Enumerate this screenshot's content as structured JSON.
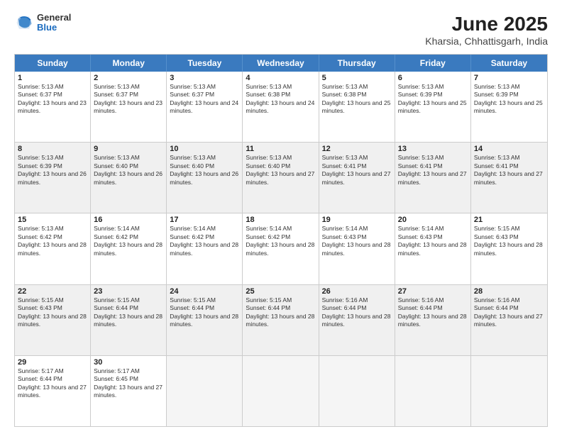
{
  "logo": {
    "general": "General",
    "blue": "Blue"
  },
  "title": {
    "month_year": "June 2025",
    "location": "Kharsia, Chhattisgarh, India"
  },
  "days_of_week": [
    "Sunday",
    "Monday",
    "Tuesday",
    "Wednesday",
    "Thursday",
    "Friday",
    "Saturday"
  ],
  "rows": [
    [
      {
        "day": "",
        "empty": true
      },
      {
        "day": "2",
        "sunrise": "Sunrise: 5:13 AM",
        "sunset": "Sunset: 6:37 PM",
        "daylight": "Daylight: 13 hours and 23 minutes."
      },
      {
        "day": "3",
        "sunrise": "Sunrise: 5:13 AM",
        "sunset": "Sunset: 6:37 PM",
        "daylight": "Daylight: 13 hours and 24 minutes."
      },
      {
        "day": "4",
        "sunrise": "Sunrise: 5:13 AM",
        "sunset": "Sunset: 6:38 PM",
        "daylight": "Daylight: 13 hours and 24 minutes."
      },
      {
        "day": "5",
        "sunrise": "Sunrise: 5:13 AM",
        "sunset": "Sunset: 6:38 PM",
        "daylight": "Daylight: 13 hours and 25 minutes."
      },
      {
        "day": "6",
        "sunrise": "Sunrise: 5:13 AM",
        "sunset": "Sunset: 6:39 PM",
        "daylight": "Daylight: 13 hours and 25 minutes."
      },
      {
        "day": "7",
        "sunrise": "Sunrise: 5:13 AM",
        "sunset": "Sunset: 6:39 PM",
        "daylight": "Daylight: 13 hours and 25 minutes."
      }
    ],
    [
      {
        "day": "8",
        "sunrise": "Sunrise: 5:13 AM",
        "sunset": "Sunset: 6:39 PM",
        "daylight": "Daylight: 13 hours and 26 minutes."
      },
      {
        "day": "9",
        "sunrise": "Sunrise: 5:13 AM",
        "sunset": "Sunset: 6:40 PM",
        "daylight": "Daylight: 13 hours and 26 minutes."
      },
      {
        "day": "10",
        "sunrise": "Sunrise: 5:13 AM",
        "sunset": "Sunset: 6:40 PM",
        "daylight": "Daylight: 13 hours and 26 minutes."
      },
      {
        "day": "11",
        "sunrise": "Sunrise: 5:13 AM",
        "sunset": "Sunset: 6:40 PM",
        "daylight": "Daylight: 13 hours and 27 minutes."
      },
      {
        "day": "12",
        "sunrise": "Sunrise: 5:13 AM",
        "sunset": "Sunset: 6:41 PM",
        "daylight": "Daylight: 13 hours and 27 minutes."
      },
      {
        "day": "13",
        "sunrise": "Sunrise: 5:13 AM",
        "sunset": "Sunset: 6:41 PM",
        "daylight": "Daylight: 13 hours and 27 minutes."
      },
      {
        "day": "14",
        "sunrise": "Sunrise: 5:13 AM",
        "sunset": "Sunset: 6:41 PM",
        "daylight": "Daylight: 13 hours and 27 minutes."
      }
    ],
    [
      {
        "day": "15",
        "sunrise": "Sunrise: 5:13 AM",
        "sunset": "Sunset: 6:42 PM",
        "daylight": "Daylight: 13 hours and 28 minutes."
      },
      {
        "day": "16",
        "sunrise": "Sunrise: 5:14 AM",
        "sunset": "Sunset: 6:42 PM",
        "daylight": "Daylight: 13 hours and 28 minutes."
      },
      {
        "day": "17",
        "sunrise": "Sunrise: 5:14 AM",
        "sunset": "Sunset: 6:42 PM",
        "daylight": "Daylight: 13 hours and 28 minutes."
      },
      {
        "day": "18",
        "sunrise": "Sunrise: 5:14 AM",
        "sunset": "Sunset: 6:42 PM",
        "daylight": "Daylight: 13 hours and 28 minutes."
      },
      {
        "day": "19",
        "sunrise": "Sunrise: 5:14 AM",
        "sunset": "Sunset: 6:43 PM",
        "daylight": "Daylight: 13 hours and 28 minutes."
      },
      {
        "day": "20",
        "sunrise": "Sunrise: 5:14 AM",
        "sunset": "Sunset: 6:43 PM",
        "daylight": "Daylight: 13 hours and 28 minutes."
      },
      {
        "day": "21",
        "sunrise": "Sunrise: 5:15 AM",
        "sunset": "Sunset: 6:43 PM",
        "daylight": "Daylight: 13 hours and 28 minutes."
      }
    ],
    [
      {
        "day": "22",
        "sunrise": "Sunrise: 5:15 AM",
        "sunset": "Sunset: 6:43 PM",
        "daylight": "Daylight: 13 hours and 28 minutes."
      },
      {
        "day": "23",
        "sunrise": "Sunrise: 5:15 AM",
        "sunset": "Sunset: 6:44 PM",
        "daylight": "Daylight: 13 hours and 28 minutes."
      },
      {
        "day": "24",
        "sunrise": "Sunrise: 5:15 AM",
        "sunset": "Sunset: 6:44 PM",
        "daylight": "Daylight: 13 hours and 28 minutes."
      },
      {
        "day": "25",
        "sunrise": "Sunrise: 5:15 AM",
        "sunset": "Sunset: 6:44 PM",
        "daylight": "Daylight: 13 hours and 28 minutes."
      },
      {
        "day": "26",
        "sunrise": "Sunrise: 5:16 AM",
        "sunset": "Sunset: 6:44 PM",
        "daylight": "Daylight: 13 hours and 28 minutes."
      },
      {
        "day": "27",
        "sunrise": "Sunrise: 5:16 AM",
        "sunset": "Sunset: 6:44 PM",
        "daylight": "Daylight: 13 hours and 28 minutes."
      },
      {
        "day": "28",
        "sunrise": "Sunrise: 5:16 AM",
        "sunset": "Sunset: 6:44 PM",
        "daylight": "Daylight: 13 hours and 27 minutes."
      }
    ],
    [
      {
        "day": "29",
        "sunrise": "Sunrise: 5:17 AM",
        "sunset": "Sunset: 6:44 PM",
        "daylight": "Daylight: 13 hours and 27 minutes."
      },
      {
        "day": "30",
        "sunrise": "Sunrise: 5:17 AM",
        "sunset": "Sunset: 6:45 PM",
        "daylight": "Daylight: 13 hours and 27 minutes."
      },
      {
        "day": "",
        "empty": true
      },
      {
        "day": "",
        "empty": true
      },
      {
        "day": "",
        "empty": true
      },
      {
        "day": "",
        "empty": true
      },
      {
        "day": "",
        "empty": true
      }
    ]
  ],
  "row0_day1": {
    "day": "1",
    "sunrise": "Sunrise: 5:13 AM",
    "sunset": "Sunset: 6:37 PM",
    "daylight": "Daylight: 13 hours and 23 minutes."
  }
}
